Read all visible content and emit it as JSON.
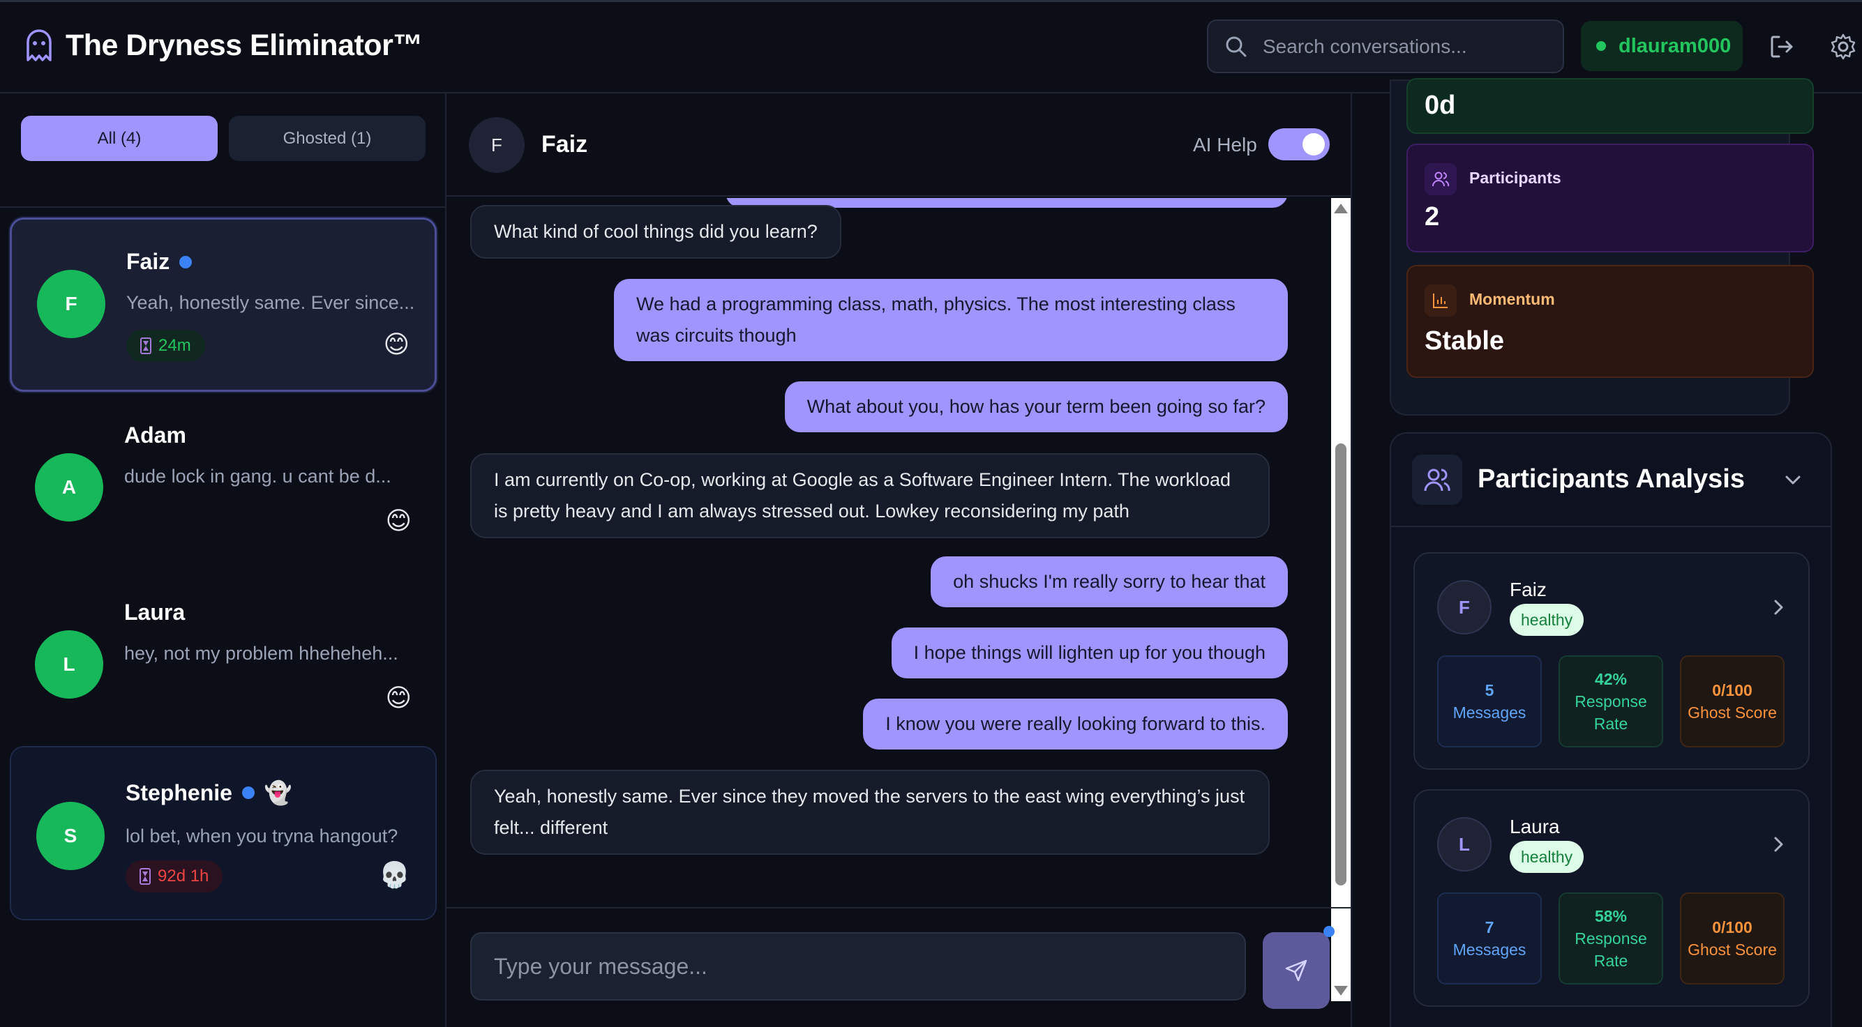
{
  "app": {
    "title": "The Dryness Eliminator™",
    "search_placeholder": "Search conversations...",
    "username": "dlauram000"
  },
  "filters": {
    "all_label": "All (4)",
    "ghosted_label": "Ghosted (1)"
  },
  "conversations": [
    {
      "initial": "F",
      "name": "Faiz",
      "preview": "Yeah, honestly same. Ever since...",
      "timer": "24m",
      "emoji": "😊",
      "unread": true
    },
    {
      "initial": "A",
      "name": "Adam",
      "preview": "dude lock in gang. u cant be d...",
      "emoji": "😊"
    },
    {
      "initial": "L",
      "name": "Laura",
      "preview": "hey, not my problem hheheheh...",
      "emoji": "😊"
    },
    {
      "initial": "S",
      "name": "Stephenie",
      "preview": "lol bet, when you tryna hangout?",
      "timer": "92d 1h",
      "emoji": "💀",
      "ghost": "👻",
      "unread": true
    }
  ],
  "chat": {
    "initial": "F",
    "name": "Faiz",
    "ai_help_label": "AI Help",
    "ai_help_on": true,
    "input_placeholder": "Type your message...",
    "messages": [
      {
        "dir": "in",
        "text": "What kind of cool things did you learn?"
      },
      {
        "dir": "out",
        "text": "We had a programming class, math, physics. The most interesting class was circuits though"
      },
      {
        "dir": "out",
        "text": "What about you, how has your term been going so far?"
      },
      {
        "dir": "in",
        "text": "I am currently on Co-op, working at Google as a Software Engineer Intern. The workload is pretty heavy and I am always stressed out. Lowkey reconsidering my path"
      },
      {
        "dir": "out",
        "text": "oh shucks I'm really sorry to hear that"
      },
      {
        "dir": "out",
        "text": "I hope things will lighten up for you though"
      },
      {
        "dir": "out",
        "text": "I know you were really looking forward to this."
      },
      {
        "dir": "in",
        "text": "Yeah, honestly same. Ever since they moved the servers to the east wing everything’s just felt... different"
      }
    ]
  },
  "stats": {
    "top_value": "0d",
    "participants_label": "Participants",
    "participants_value": "2",
    "momentum_label": "Momentum",
    "momentum_value": "Stable"
  },
  "analysis": {
    "title": "Participants Analysis",
    "people": [
      {
        "initial": "F",
        "name": "Faiz",
        "status": "healthy",
        "messages": "5",
        "messages_label": "Messages",
        "response_rate": "42%",
        "response_label": "Response Rate",
        "ghost_score": "0/100",
        "ghost_label": "Ghost Score"
      },
      {
        "initial": "L",
        "name": "Laura",
        "status": "healthy",
        "messages": "7",
        "messages_label": "Messages",
        "response_rate": "58%",
        "response_label": "Response Rate",
        "ghost_score": "0/100",
        "ghost_label": "Ghost Score"
      }
    ]
  },
  "colors": {
    "accent": "#a094ff",
    "online": "#22c55e",
    "avatar": "#16b85a",
    "danger": "#ef4444"
  }
}
